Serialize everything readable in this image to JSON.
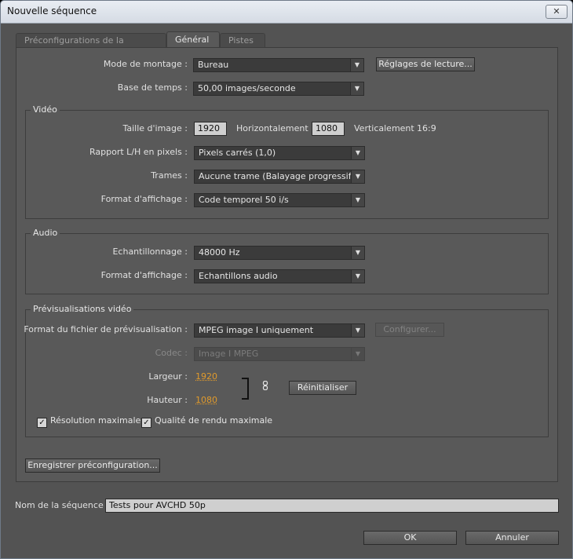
{
  "window": {
    "title": "Nouvelle séquence",
    "close_glyph": "✕"
  },
  "tabs": [
    {
      "label": "Préconfigurations de la séquence",
      "active": false
    },
    {
      "label": "Général",
      "active": true
    },
    {
      "label": "Pistes",
      "active": false
    }
  ],
  "general": {
    "mode_montage": {
      "label": "Mode de montage :",
      "value": "Bureau"
    },
    "reglages_lecture_label": "Réglages de lecture...",
    "base_temps": {
      "label": "Base de temps :",
      "value": "50,00 images/seconde"
    }
  },
  "video": {
    "title": "Vidéo",
    "taille_label": "Taille d'image :",
    "horizontal_value": "1920",
    "horizontal_label": "Horizontalement",
    "vertical_value": "1080",
    "vertical_label": "Verticalement",
    "ratio": "16:9",
    "rapport": {
      "label": "Rapport L/H en pixels :",
      "value": "Pixels carrés (1,0)"
    },
    "trames": {
      "label": "Trames :",
      "value": "Aucune trame (Balayage progressif)"
    },
    "format_affichage": {
      "label": "Format d'affichage :",
      "value": "Code temporel 50 i/s"
    }
  },
  "audio": {
    "title": "Audio",
    "echantillonnage": {
      "label": "Echantillonnage :",
      "value": "48000 Hz"
    },
    "format_affichage": {
      "label": "Format d'affichage :",
      "value": "Echantillons audio"
    }
  },
  "previews": {
    "title": "Prévisualisations vidéo",
    "format_fichier": {
      "label": "Format du fichier de prévisualisation :",
      "value": "MPEG image I uniquement"
    },
    "configurer_label": "Configurer...",
    "codec": {
      "label": "Codec :",
      "value": "Image I MPEG",
      "disabled": true
    },
    "largeur": {
      "label": "Largeur :",
      "value": "1920"
    },
    "hauteur": {
      "label": "Hauteur :",
      "value": "1080"
    },
    "reinitialiser_label": "Réinitialiser",
    "resolution_max": {
      "label": "Résolution maximale",
      "checked": true
    },
    "qualite_max": {
      "label": "Qualité de rendu maximale",
      "checked": true
    }
  },
  "enregistrer_label": "Enregistrer préconfiguration...",
  "sequence_name": {
    "label": "Nom de la séquence :",
    "value": "Tests pour AVCHD 50p"
  },
  "ok_label": "OK",
  "annuler_label": "Annuler",
  "icons": {
    "dropdown": "▼",
    "checkmark": "✓",
    "link": "chain-link-icon"
  }
}
